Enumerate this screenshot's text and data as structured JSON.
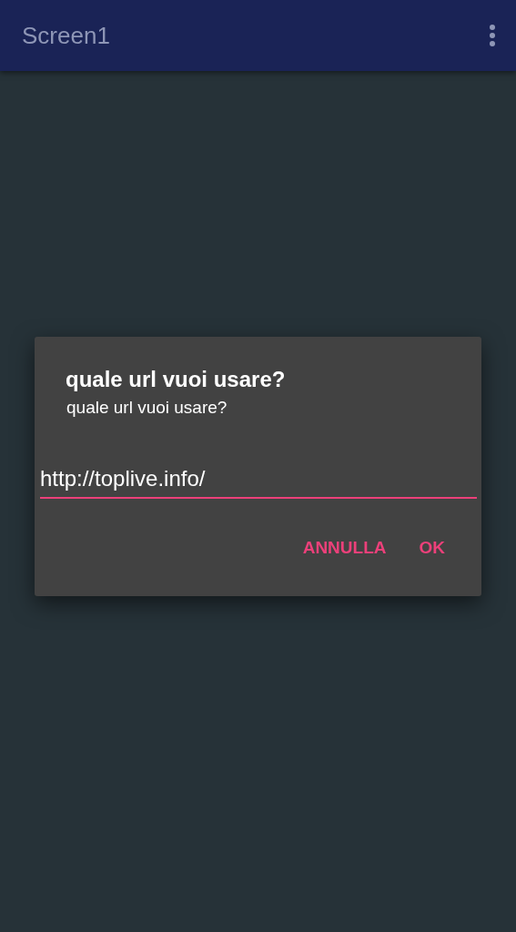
{
  "app_bar": {
    "title": "Screen1"
  },
  "dialog": {
    "title": "quale url vuoi usare?",
    "message": "quale url vuoi usare?",
    "input": {
      "value": "http://toplive.info/",
      "focused": true
    },
    "buttons": [
      "ANNULLA",
      "OK"
    ]
  }
}
